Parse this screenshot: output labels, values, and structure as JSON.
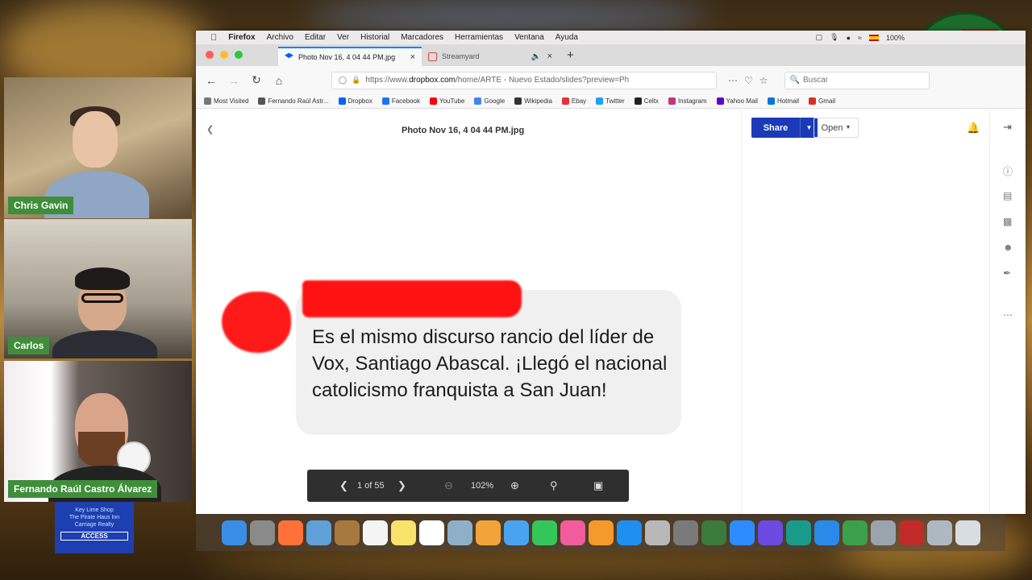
{
  "participants": [
    {
      "name": "Chris Gavin"
    },
    {
      "name": "Carlos"
    },
    {
      "name": "Fernando Raúl Castro Álvarez"
    }
  ],
  "sign": {
    "line1": "Key Lime Shop",
    "line2": "The Pirate Haus Inn",
    "line3": "Carriage Realty",
    "access": "ACCESS"
  },
  "menubar": {
    "items": [
      "Firefox",
      "Archivo",
      "Editar",
      "Ver",
      "Historial",
      "Marcadores",
      "Herramientas",
      "Ventana",
      "Ayuda"
    ],
    "battery": "100%"
  },
  "tabs": [
    {
      "title": "Photo Nov 16, 4 04 44 PM.jpg",
      "active": true
    },
    {
      "title": "Streamyard",
      "active": false
    }
  ],
  "navbar": {
    "url_prefix": "https://www.",
    "url_domain": "dropbox.com",
    "url_rest": "/home/ARTE - Nuevo Estado/slides?preview=Ph",
    "search_placeholder": "Buscar"
  },
  "bookmarks": [
    {
      "label": "Most Visited",
      "color": "#777777"
    },
    {
      "label": "Fernando Raúl Astr...",
      "color": "#555555"
    },
    {
      "label": "Dropbox",
      "color": "#0061fe"
    },
    {
      "label": "Facebook",
      "color": "#1877f2"
    },
    {
      "label": "YouTube",
      "color": "#ff0000"
    },
    {
      "label": "Google",
      "color": "#4285f4"
    },
    {
      "label": "Wikipedia",
      "color": "#333333"
    },
    {
      "label": "Ebay",
      "color": "#e53238"
    },
    {
      "label": "Twitter",
      "color": "#1da1f2"
    },
    {
      "label": "Celtx",
      "color": "#222222"
    },
    {
      "label": "Instagram",
      "color": "#c13584"
    },
    {
      "label": "Yahoo Mail",
      "color": "#6001d2"
    },
    {
      "label": "Hotmail",
      "color": "#0078d4"
    },
    {
      "label": "Gmail",
      "color": "#d93025"
    }
  ],
  "preview": {
    "file_title": "Photo Nov 16, 4 04 44 PM.jpg",
    "share_label": "Share",
    "open_label": "Open",
    "message": "Es el mismo discurso rancio del líder de Vox, Santiago Abascal. ¡Llegó el nacional catolicismo franquista a San Juan!",
    "page_indicator": "1 of 55",
    "zoom": "102%"
  },
  "colors": {
    "share_blue": "#1a3ab8",
    "cam_label_green": "#3f8e3a",
    "redaction_red": "#ff1212",
    "toolbar_dark": "#2f2f2f"
  },
  "dock_icons": [
    {
      "name": "finder-icon",
      "color": "#3a8ee6"
    },
    {
      "name": "launchpad-icon",
      "color": "#8a8a8a"
    },
    {
      "name": "firefox-icon",
      "color": "#ff7139"
    },
    {
      "name": "preview-icon",
      "color": "#5fa0d8"
    },
    {
      "name": "notes-brown-icon",
      "color": "#a8793e"
    },
    {
      "name": "calendar-icon",
      "color": "#f4f4f4"
    },
    {
      "name": "stickies-icon",
      "color": "#f7e36a"
    },
    {
      "name": "textedit-icon",
      "color": "#ffffff"
    },
    {
      "name": "photos-browser-icon",
      "color": "#8db0c8"
    },
    {
      "name": "photos-icon",
      "color": "#f2a33a"
    },
    {
      "name": "messages-blue-icon",
      "color": "#4aa3f0"
    },
    {
      "name": "facetime-icon",
      "color": "#33c75a"
    },
    {
      "name": "itunes-icon",
      "color": "#f05c9c"
    },
    {
      "name": "books-icon",
      "color": "#f49a2a"
    },
    {
      "name": "app-store-icon",
      "color": "#1e90f0"
    },
    {
      "name": "files-icon",
      "color": "#b8b8b8"
    },
    {
      "name": "system-preferences-icon",
      "color": "#7a7a7a"
    },
    {
      "name": "photoshop-icon",
      "color": "#3a7a3a"
    },
    {
      "name": "zoom-icon",
      "color": "#2d8cff"
    },
    {
      "name": "imovie-star-icon",
      "color": "#6a4ae0"
    },
    {
      "name": "dreamweaver-icon",
      "color": "#1a9a8a"
    },
    {
      "name": "safari-icon",
      "color": "#2a8ae8"
    },
    {
      "name": "network-globe-icon",
      "color": "#3aa04a"
    },
    {
      "name": "utility-icon",
      "color": "#9aa4ae"
    },
    {
      "name": "case-icon",
      "color": "#c22a2a"
    },
    {
      "name": "archive-icon",
      "color": "#aeb8c2"
    },
    {
      "name": "trash-icon",
      "color": "#d8dde2"
    }
  ]
}
